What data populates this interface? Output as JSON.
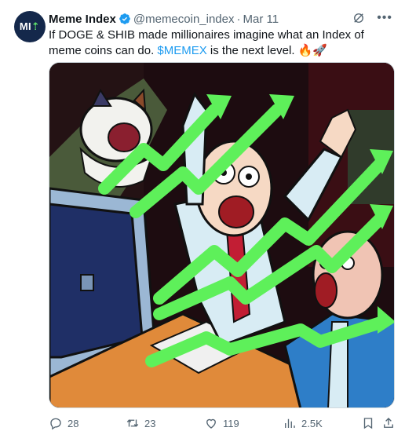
{
  "author": {
    "name": "Meme Index",
    "handle": "@memecoin_index",
    "separator": "·",
    "time": "Mar 11",
    "avatar_text": "MI",
    "avatar_mark": "⇡",
    "verified_color": "#1d9bf0"
  },
  "tweet": {
    "text_before": "If DOGE & SHIB made millionaires imagine what an Index of meme coins can do. ",
    "cashtag": "$MEMEX",
    "text_after": " is the next level. 🔥🚀"
  },
  "media": {
    "description_icon": "meme-illustration-image"
  },
  "actions": {
    "replies": "28",
    "reposts": "23",
    "likes": "119",
    "views": "2.5K"
  },
  "colors": {
    "accent": "#1d9bf0",
    "muted": "#536471",
    "arrow_green": "#5ef05a"
  }
}
